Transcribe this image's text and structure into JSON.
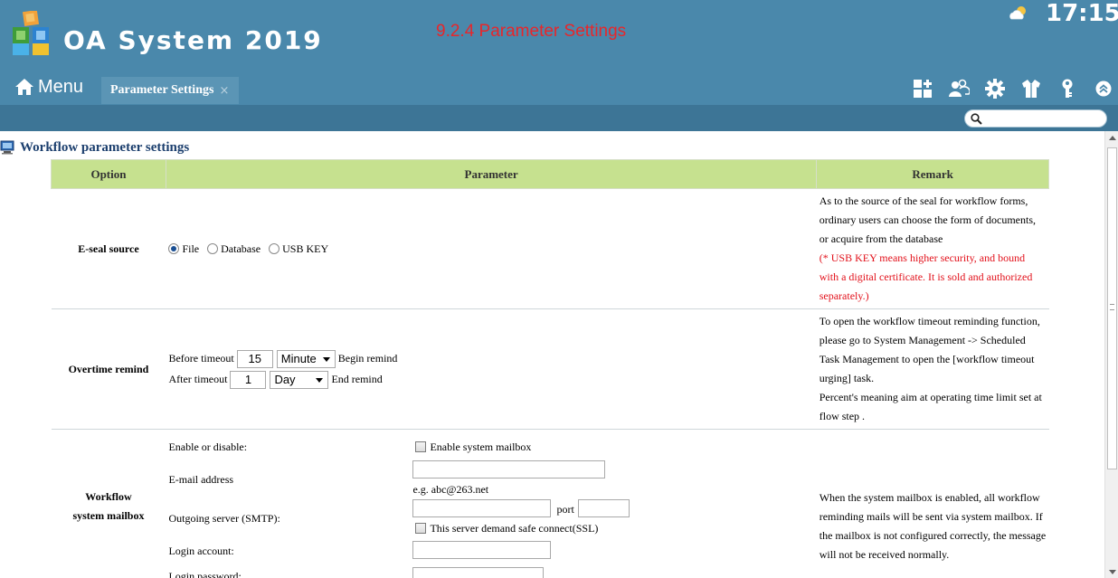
{
  "header": {
    "app_title": "OA System 2019",
    "doc_heading": "9.2.4 Parameter Settings",
    "clock": "17:15",
    "menu_label": "Menu",
    "active_tab": "Parameter Settings",
    "tab_close": "×",
    "toolbar_icons": [
      "dashboard-add-icon",
      "users-icon",
      "gear-icon",
      "shirt-icon",
      "key-icon",
      "collapse-up-icon"
    ],
    "search": {
      "placeholder": ""
    }
  },
  "section": {
    "title": "Workflow parameter settings"
  },
  "table": {
    "headers": {
      "option": "Option",
      "parameter": "Parameter",
      "remark": "Remark"
    },
    "eseal": {
      "option": "E-seal source",
      "choices": [
        "File",
        "Database",
        "USB KEY"
      ],
      "selected": "File",
      "remark": "As to the source of the seal for workflow forms, ordinary users can choose the form of documents, or acquire from the database",
      "remark_note": "(* USB KEY means higher security, and bound with a digital certificate. It is sold and authorized separately.)"
    },
    "overtime": {
      "option": "Overtime remind",
      "before_label": "Before timeout",
      "before_value": "15",
      "before_unit": "Minute",
      "before_suffix": "Begin remind",
      "after_label": "After timeout",
      "after_value": "1",
      "after_unit": "Day",
      "after_suffix": "End remind",
      "remark": "To open the workflow timeout reminding function, please go to System Management -> Scheduled Task Management to open the [workflow timeout urging] task.",
      "remark_2": "Percent's meaning aim at operating time limit set at flow step ."
    },
    "mailbox": {
      "option": "Workflow system mailbox",
      "enable_label": "Enable or disable:",
      "enable_checkbox": "Enable system mailbox",
      "email_label": "E-mail address",
      "email_value": "",
      "email_hint": "e.g. abc@263.net",
      "smtp_label": "Outgoing server (SMTP):",
      "smtp_value": "",
      "port_label": "port",
      "port_value": "",
      "ssl_checkbox": "This server demand safe connect(SSL)",
      "login_account_label": "Login account:",
      "login_account_value": "",
      "login_password_label": "Login password:",
      "remark": "When the system mailbox is enabled, all workflow reminding mails will be sent via system mailbox. If the mailbox is not configured correctly, the message will not be received normally."
    }
  },
  "colors": {
    "header_bg": "#4a88ab",
    "subbar_bg": "#3d7596",
    "table_header_bg": "#c6e18f",
    "heading_red": "#e8262a",
    "note_red": "#e2101a"
  }
}
